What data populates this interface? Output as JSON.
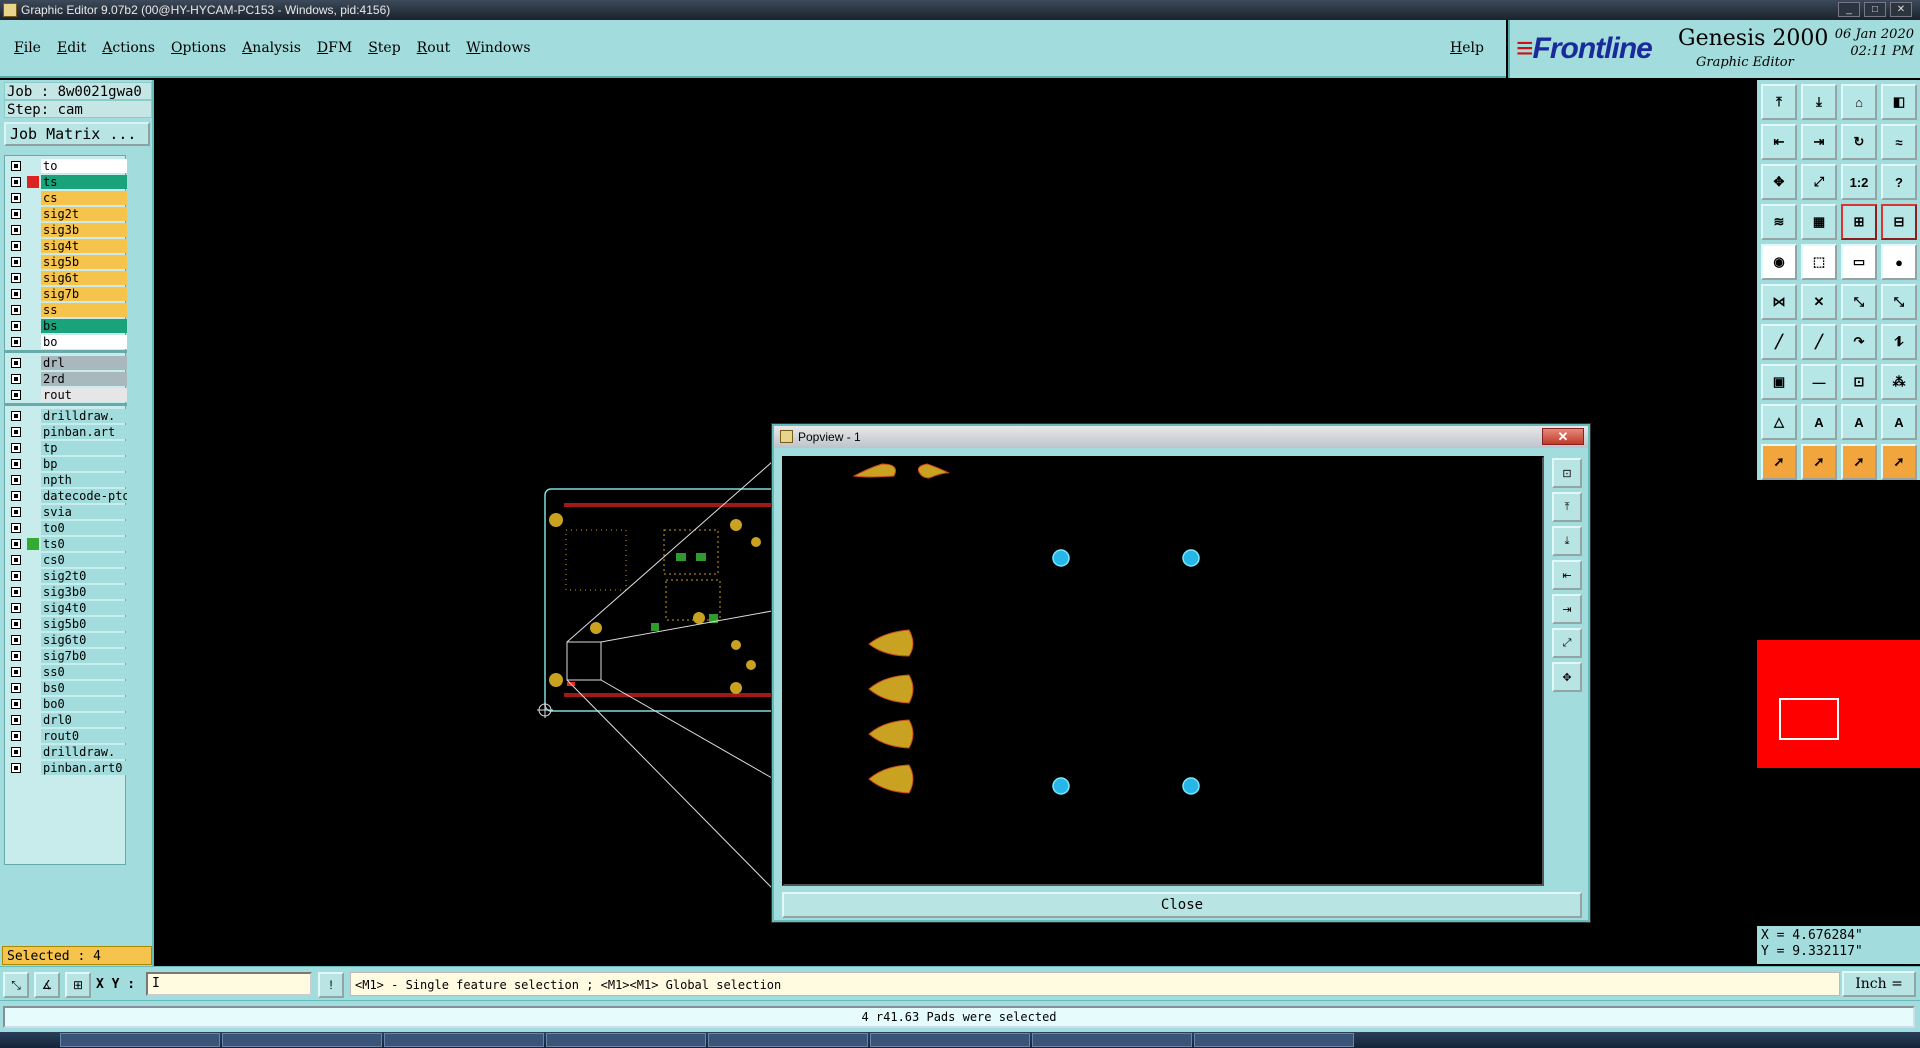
{
  "window": {
    "title": "Graphic Editor 9.07b2 (00@HY-HYCAM-PC153 - Windows, pid:4156)",
    "min": "_",
    "max": "□",
    "close": "✕"
  },
  "menu": {
    "items": [
      "File",
      "Edit",
      "Actions",
      "Options",
      "Analysis",
      "DFM",
      "Step",
      "Rout",
      "Windows"
    ],
    "help": "Help"
  },
  "brand": {
    "logo_mark": "≡",
    "logo": "Frontline",
    "product": "Genesis 2000",
    "subtitle": "Graphic Editor",
    "date": "06 Jan 2020",
    "time": "02:11 PM"
  },
  "job": {
    "job_line": "Job : 8w0021gwa0",
    "step_line": "Step: cam",
    "matrix_button": "Job Matrix ..."
  },
  "layers": [
    {
      "name": "to",
      "color": "#ffffff"
    },
    {
      "name": "ts",
      "color": "#1aa37a",
      "active": true
    },
    {
      "name": "cs",
      "color": "#f6c44c"
    },
    {
      "name": "sig2t",
      "color": "#f6c44c"
    },
    {
      "name": "sig3b",
      "color": "#f6c44c"
    },
    {
      "name": "sig4t",
      "color": "#f6c44c"
    },
    {
      "name": "sig5b",
      "color": "#f6c44c"
    },
    {
      "name": "sig6t",
      "color": "#f6c44c"
    },
    {
      "name": "sig7b",
      "color": "#f6c44c"
    },
    {
      "name": "ss",
      "color": "#f6c44c"
    },
    {
      "name": "bs",
      "color": "#1aa37a"
    },
    {
      "name": "bo",
      "color": "#ffffff"
    },
    {
      "name": "drl",
      "color": "#a8b8bc",
      "group_start": true
    },
    {
      "name": "2rd",
      "color": "#a8b8bc"
    },
    {
      "name": "rout",
      "color": "#e6e6e6"
    },
    {
      "name": "drilldraw.",
      "color": "#a3dcdc",
      "group_start": true
    },
    {
      "name": "pinban.art",
      "color": "#a3dcdc"
    },
    {
      "name": "tp",
      "color": "#a3dcdc"
    },
    {
      "name": "bp",
      "color": "#a3dcdc"
    },
    {
      "name": "npth",
      "color": "#a3dcdc"
    },
    {
      "name": "datecode-pto",
      "color": "#a3dcdc"
    },
    {
      "name": "svia",
      "color": "#a3dcdc"
    },
    {
      "name": "to0",
      "color": "#a3dcdc"
    },
    {
      "name": "ts0",
      "color": "#a3dcdc",
      "marker": true
    },
    {
      "name": "cs0",
      "color": "#a3dcdc"
    },
    {
      "name": "sig2t0",
      "color": "#a3dcdc"
    },
    {
      "name": "sig3b0",
      "color": "#a3dcdc"
    },
    {
      "name": "sig4t0",
      "color": "#a3dcdc"
    },
    {
      "name": "sig5b0",
      "color": "#a3dcdc"
    },
    {
      "name": "sig6t0",
      "color": "#a3dcdc"
    },
    {
      "name": "sig7b0",
      "color": "#a3dcdc"
    },
    {
      "name": "ss0",
      "color": "#a3dcdc"
    },
    {
      "name": "bs0",
      "color": "#a3dcdc"
    },
    {
      "name": "bo0",
      "color": "#a3dcdc"
    },
    {
      "name": "drl0",
      "color": "#a3dcdc"
    },
    {
      "name": "rout0",
      "color": "#a3dcdc"
    },
    {
      "name": "drilldraw.",
      "color": "#a3dcdc"
    },
    {
      "name": "pinban.art0",
      "color": "#a3dcdc"
    }
  ],
  "selected": {
    "text": "Selected : 4"
  },
  "toolbar": {
    "rows": [
      [
        "⤒",
        "⤓",
        "⌂",
        "◧"
      ],
      [
        "⇤",
        "⇥",
        "↻",
        "≈"
      ],
      [
        "✥",
        "⤢",
        "1:2",
        "?"
      ],
      [
        "≋",
        "▦",
        "⊞",
        "⊟"
      ],
      [
        "◉",
        "⬚",
        "▭",
        "●"
      ],
      [
        "⋈",
        "✕",
        "⤡",
        "⤡"
      ],
      [
        "╱",
        "╱",
        "↷",
        "⥮"
      ],
      [
        "▣",
        "—",
        "⊡",
        "⁂"
      ],
      [
        "△",
        "A",
        "A",
        "A"
      ],
      [
        "➚",
        "➚",
        "➚",
        "➚"
      ]
    ]
  },
  "coords": {
    "x": "X = 4.676284\"",
    "y": "Y = 9.332117\""
  },
  "bottom": {
    "xy_label": "X Y :",
    "xy_value": "",
    "cursor": "I",
    "info_icon": "!",
    "prompt": "<M1> - Single feature selection ; <M1><M1> Global selection",
    "unit": "Inch",
    "unit_arrow": "="
  },
  "status": {
    "message": "4 r41.63 Pads were selected"
  },
  "popview": {
    "title": "Popview - 1",
    "close_label": "Close",
    "close_x": "✕",
    "side_buttons": [
      "⊡",
      "⤒",
      "⤓",
      "⇤",
      "⇥",
      "⤢",
      "✥"
    ]
  }
}
